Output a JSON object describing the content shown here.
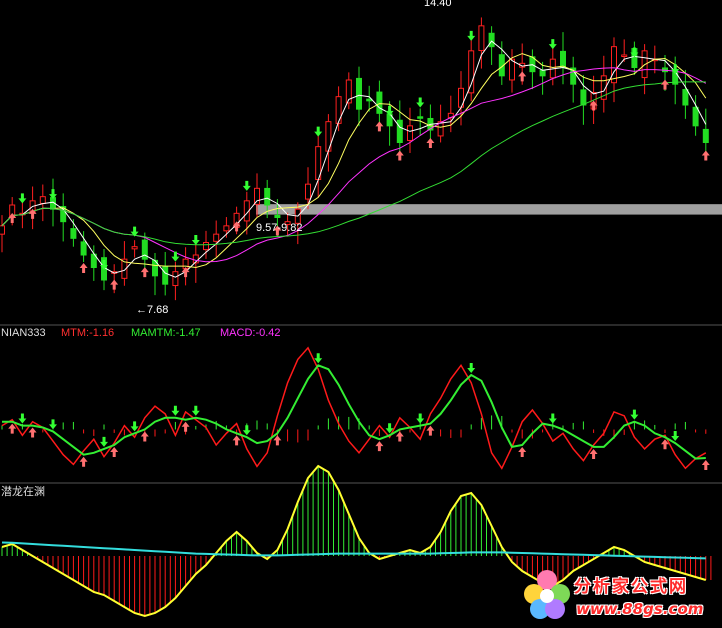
{
  "colors": {
    "background": "#000000",
    "separator": "#555555",
    "up_candle": "#ff2020",
    "down_candle": "#22dd22",
    "ma_white": "#ffffff",
    "ma_yellow": "#ffff60",
    "ma_magenta": "#ff33ff",
    "ma_green": "#33dd33",
    "band": "#a0a0a0",
    "mtm": "#ff1a1a",
    "mamtm": "#33ee33",
    "macd_text": "#ff33ff",
    "osc_yellow": "#ffff30",
    "osc_cyan": "#33dddd"
  },
  "chart_data": [
    {
      "type": "candlestick",
      "title": "",
      "annotations": {
        "high_label": "14.40",
        "low_label": "←7.68",
        "range_label": "9.57-9.82"
      },
      "close": [
        9.3,
        9.8,
        9.6,
        9.9,
        10.0,
        9.7,
        9.4,
        9.0,
        8.6,
        8.3,
        8.0,
        8.2,
        8.5,
        8.8,
        8.5,
        8.1,
        7.9,
        8.2,
        8.5,
        8.6,
        8.9,
        9.1,
        9.3,
        9.6,
        9.9,
        10.2,
        9.8,
        9.5,
        9.4,
        9.7,
        10.3,
        11.2,
        11.8,
        12.4,
        12.8,
        12.1,
        12.3,
        12.0,
        11.7,
        11.3,
        11.7,
        11.9,
        11.6,
        11.8,
        12.0,
        12.6,
        13.5,
        14.1,
        13.6,
        12.9,
        13.3,
        13.2,
        13.0,
        12.9,
        13.3,
        13.1,
        12.7,
        12.2,
        12.5,
        12.9,
        13.6,
        13.4,
        13.1,
        13.5,
        13.3,
        13.0,
        12.7,
        12.2,
        11.7,
        11.3
      ]
    },
    {
      "type": "line",
      "title": "NIAN333",
      "indicator_labels": [
        "MTM:-1.16",
        "MAMTM:-1.47",
        "MACD:-0.42"
      ],
      "series": [
        {
          "name": "MTM",
          "values": [
            0.2,
            0.5,
            -0.3,
            0.4,
            0.1,
            -0.6,
            -1.3,
            -1.8,
            -1.1,
            -0.5,
            -1.4,
            -0.7,
            0.2,
            -0.4,
            0.6,
            1.2,
            0.8,
            -0.3,
            0.9,
            0.5,
            0.1,
            -0.8,
            -0.2,
            0.3,
            -1.0,
            -1.9,
            -1.2,
            0.7,
            2.4,
            3.6,
            4.2,
            3.1,
            1.5,
            0.3,
            -0.6,
            -1.2,
            -0.5,
            0.2,
            -0.4,
            0.6,
            0.1,
            -0.5,
            0.8,
            1.6,
            2.6,
            3.3,
            2.4,
            0.8,
            -1.2,
            -2.0,
            -0.9,
            0.4,
            1.0,
            0.3,
            -0.6,
            -0.2,
            -1.0,
            -1.6,
            -0.8,
            -0.2,
            0.9,
            0.7,
            -0.4,
            -1.0,
            -0.5,
            -0.3,
            -1.3,
            -2.0,
            -1.5,
            -1.2
          ]
        },
        {
          "name": "MAMTM",
          "values": [
            0.4,
            0.4,
            0.2,
            0.2,
            0.1,
            -0.1,
            -0.5,
            -0.9,
            -1.3,
            -1.2,
            -1.0,
            -0.8,
            -0.4,
            -0.2,
            0.0,
            0.4,
            0.6,
            0.6,
            0.5,
            0.6,
            0.5,
            0.3,
            0.0,
            -0.2,
            -0.4,
            -0.7,
            -0.6,
            -0.2,
            0.6,
            1.6,
            2.6,
            3.3,
            3.1,
            2.3,
            1.3,
            0.4,
            -0.3,
            -0.5,
            -0.3,
            0.0,
            0.1,
            0.2,
            0.3,
            0.8,
            1.5,
            2.3,
            2.8,
            2.5,
            1.4,
            0.1,
            -0.9,
            -0.8,
            -0.2,
            0.3,
            0.2,
            0.0,
            -0.3,
            -0.6,
            -0.9,
            -0.9,
            -0.4,
            0.2,
            0.4,
            0.2,
            -0.2,
            -0.4,
            -0.7,
            -1.1,
            -1.5,
            -1.47
          ]
        }
      ]
    },
    {
      "type": "bar",
      "title": "潜龙在渊",
      "series": [
        {
          "name": "osc",
          "values": [
            0.3,
            0.4,
            0.2,
            0.0,
            -0.2,
            -0.4,
            -0.6,
            -0.8,
            -1.0,
            -1.2,
            -1.3,
            -1.5,
            -1.7,
            -1.9,
            -2.0,
            -1.9,
            -1.7,
            -1.4,
            -1.0,
            -0.6,
            -0.3,
            0.1,
            0.5,
            0.8,
            0.5,
            0.1,
            -0.1,
            0.2,
            0.9,
            1.8,
            2.6,
            3.0,
            2.8,
            2.2,
            1.4,
            0.6,
            0.1,
            -0.1,
            0.0,
            0.1,
            0.2,
            0.1,
            0.3,
            0.8,
            1.5,
            2.0,
            2.1,
            1.7,
            1.0,
            0.3,
            -0.2,
            -0.5,
            -0.7,
            -0.9,
            -1.0,
            -0.8,
            -0.5,
            -0.3,
            -0.1,
            0.1,
            0.3,
            0.2,
            0.0,
            -0.2,
            -0.3,
            -0.4,
            -0.5,
            -0.6,
            -0.7,
            -0.8
          ]
        },
        {
          "name": "cyan",
          "values": [
            0.45,
            0.44,
            0.42,
            0.4,
            0.38,
            0.36,
            0.34,
            0.32,
            0.3,
            0.28,
            0.26,
            0.24,
            0.22,
            0.2,
            0.18,
            0.16,
            0.14,
            0.12,
            0.1,
            0.08,
            0.07,
            0.06,
            0.05,
            0.04,
            0.03,
            0.02,
            0.02,
            0.02,
            0.03,
            0.04,
            0.05,
            0.06,
            0.07,
            0.08,
            0.08,
            0.08,
            0.08,
            0.08,
            0.08,
            0.08,
            0.08,
            0.08,
            0.08,
            0.09,
            0.1,
            0.11,
            0.12,
            0.12,
            0.12,
            0.12,
            0.11,
            0.1,
            0.09,
            0.08,
            0.07,
            0.06,
            0.05,
            0.04,
            0.03,
            0.02,
            0.01,
            0.0,
            -0.01,
            -0.02,
            -0.03,
            -0.04,
            -0.05,
            -0.06,
            -0.07,
            -0.08
          ]
        }
      ]
    }
  ],
  "watermark": {
    "title": "分析家公式网",
    "url": "www.88gs.com"
  }
}
